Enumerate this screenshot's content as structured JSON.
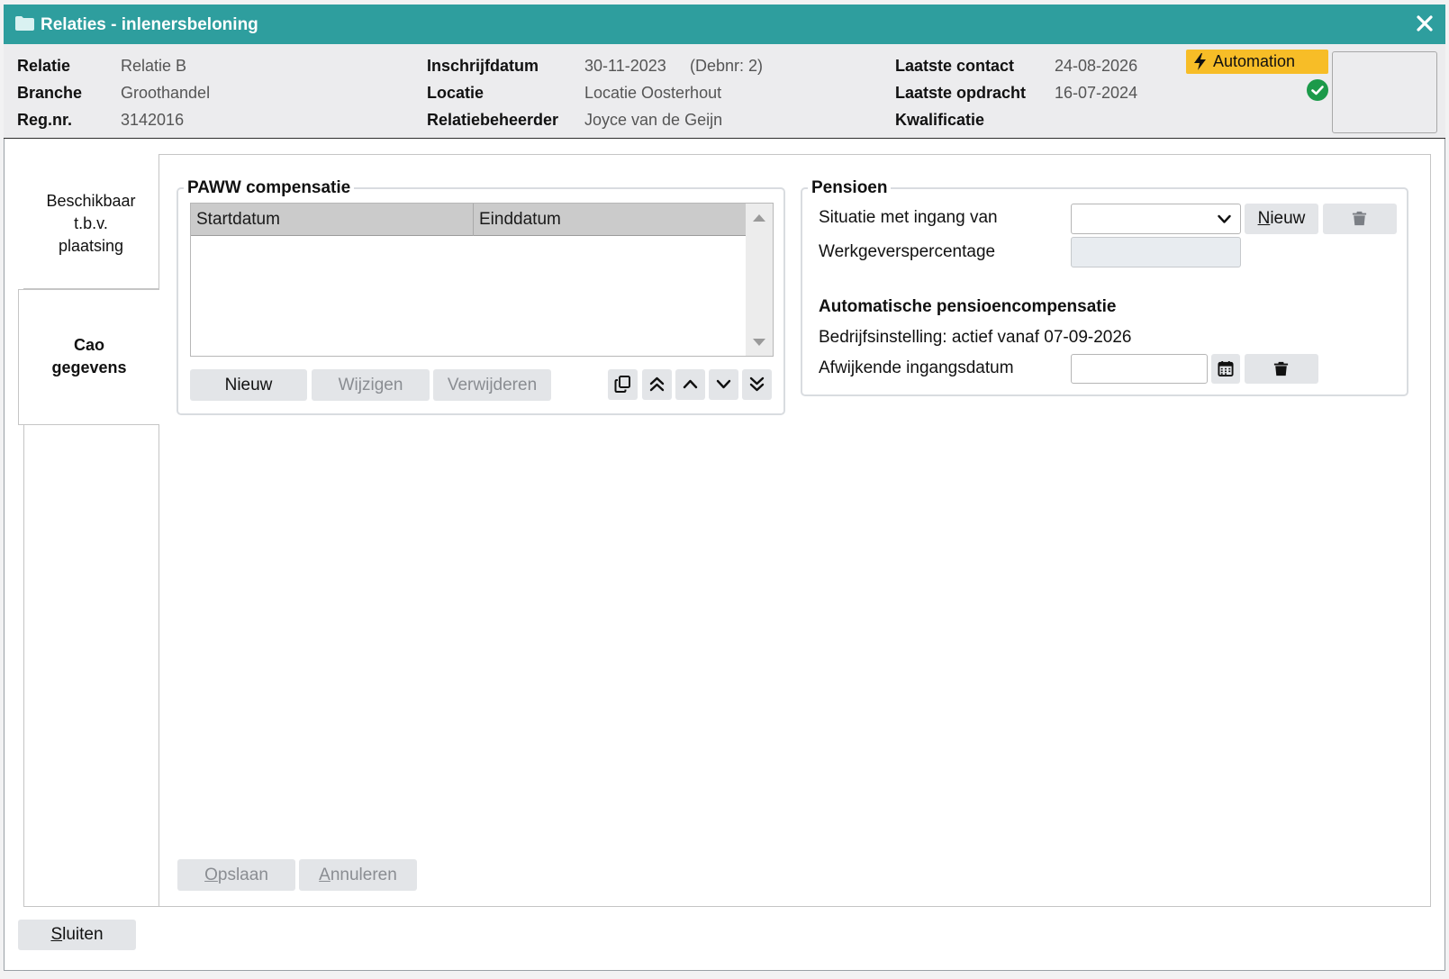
{
  "window": {
    "title": "Relaties - inlenersbeloning"
  },
  "header": {
    "relatie_label": "Relatie",
    "relatie_value": "Relatie B",
    "branche_label": "Branche",
    "branche_value": "Groothandel",
    "regnr_label": "Reg.nr.",
    "regnr_value": "3142016",
    "inschrijfdatum_label": "Inschrijfdatum",
    "inschrijfdatum_value": "30-11-2023",
    "debnr_value": "(Debnr: 2)",
    "locatie_label": "Locatie",
    "locatie_value": "Locatie Oosterhout",
    "relatiebeheerder_label": "Relatiebeheerder",
    "relatiebeheerder_value": "Joyce van de Geijn",
    "laatste_contact_label": "Laatste contact",
    "laatste_contact_value": "24-08-2026",
    "laatste_opdracht_label": "Laatste opdracht",
    "laatste_opdracht_value": "16-07-2024",
    "kwalificatie_label": "Kwalificatie",
    "automation_badge": "Automation"
  },
  "tabs": [
    {
      "label_lines": [
        "Beschikbaar",
        "t.b.v.",
        "plaatsing"
      ],
      "active": false
    },
    {
      "label_lines": [
        "Cao",
        "gegevens"
      ],
      "active": true
    }
  ],
  "paww": {
    "legend": "PAWW compensatie",
    "columns": [
      "Startdatum",
      "Einddatum"
    ],
    "rows": [],
    "buttons": {
      "new": "Nieuw",
      "edit": "Wijzigen",
      "delete": "Verwijderen"
    },
    "icons": [
      "copy-icon",
      "double-chevron-up-icon",
      "chevron-up-icon",
      "chevron-down-icon",
      "double-chevron-down-icon"
    ]
  },
  "pensioen": {
    "legend": "Pensioen",
    "situatie_label": "Situatie met ingang van",
    "situatie_value": "",
    "nieuw_button_prefix": "N",
    "nieuw_button_rest": "ieuw",
    "werkgeverspercentage_label": "Werkgeverspercentage",
    "werkgeverspercentage_value": "",
    "auto_title": "Automatische pensioencompensatie",
    "bedrijfsinstelling_text": "Bedrijfsinstelling: actief vanaf 07-09-2026",
    "afwijkende_label": "Afwijkende ingangsdatum",
    "afwijkende_value": ""
  },
  "footer": {
    "save_prefix": "O",
    "save_rest": "pslaan",
    "cancel_prefix": "A",
    "cancel_rest": "nnuleren",
    "close_prefix": "S",
    "close_rest": "luiten"
  },
  "colors": {
    "titlebar": "#2e9e9e",
    "automation_badge": "#f7bd27",
    "check": "#1c9a4a"
  }
}
